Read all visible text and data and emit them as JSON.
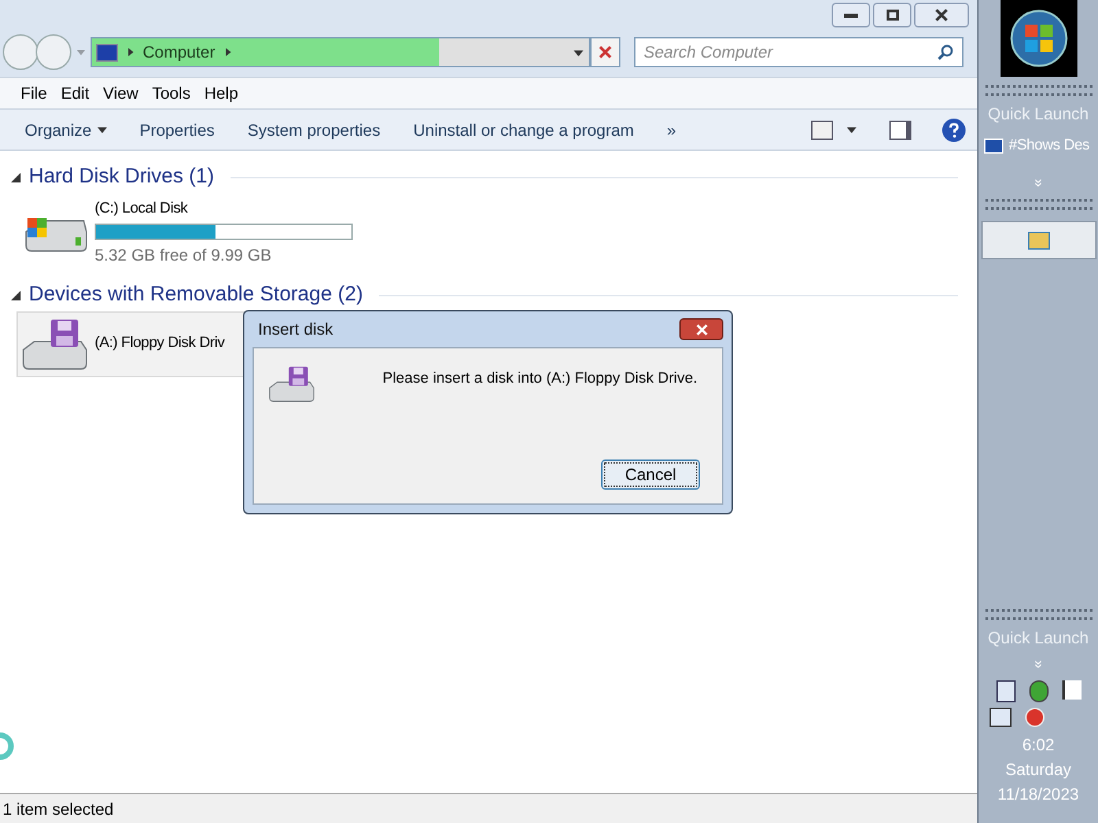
{
  "address_bar": {
    "location": "Computer",
    "level": 0.7
  },
  "search": {
    "placeholder": "Search Computer"
  },
  "menu": [
    "File",
    "Edit",
    "View",
    "Tools",
    "Help"
  ],
  "toolbar": [
    "Organize",
    "Properties",
    "System properties",
    "Uninstall or change a program",
    "»"
  ],
  "groups": [
    {
      "title": "Hard Disk Drives (1)",
      "expanded": true,
      "items": [
        {
          "kind": "disk",
          "name": "(C:) Local Disk",
          "level": 0.47,
          "free": "5.32 GB free of 9.99 GB",
          "selected": false
        }
      ]
    },
    {
      "title": "Devices with Removable Storage (2)",
      "expanded": true,
      "items": [
        {
          "kind": "floppy",
          "name": "(A:) Floppy Disk Driv",
          "selected": true
        }
      ]
    }
  ],
  "status_bar": "1 item selected",
  "dialog": {
    "title": "Insert disk",
    "message": "Please insert a disk into (A:) Floppy Disk Drive.",
    "button": "Cancel"
  },
  "taskbar": {
    "quick_launch_top": "Quick Launch",
    "shortcut": "#Shows Des",
    "chevron": "»",
    "quick_launch_bottom": "Quick Launch",
    "time": "6:02",
    "day": "Saturday",
    "date": "11/18/2023"
  }
}
